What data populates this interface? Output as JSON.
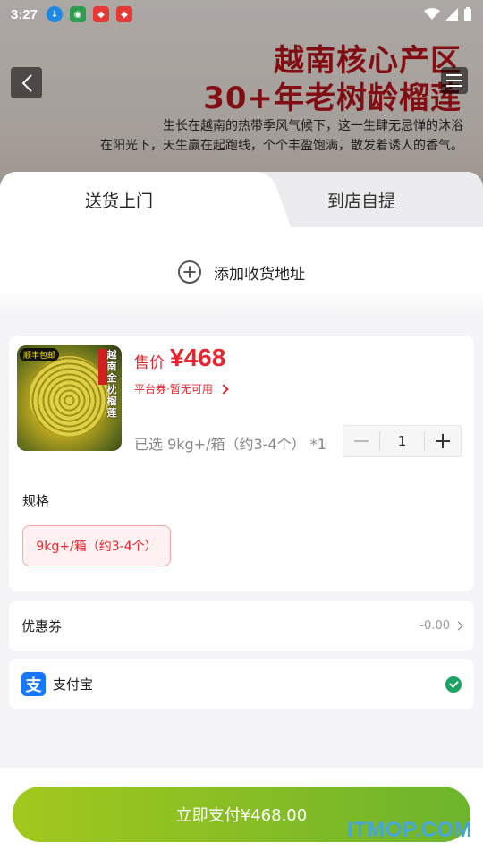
{
  "status_bar": {
    "time": "3:27"
  },
  "hero": {
    "title_line1": "越南核心产区",
    "title_line2": "30+年老树龄榴莲",
    "desc_line1": "生长在越南的热带季风气候下，这一生肆无忌惮的沐浴",
    "desc_line2": "在阳光下，天生赢在起跑线，个个丰盈饱满，散发着诱人的香气。"
  },
  "tabs": [
    {
      "label": "送货上门",
      "active": true
    },
    {
      "label": "到店自提",
      "active": false
    }
  ],
  "address": {
    "add_label": "添加收货地址"
  },
  "product": {
    "image_badge": "顺丰包邮",
    "image_stamp": "越南金枕榴莲",
    "price_label": "售价",
    "price_value": "¥468",
    "coupon_text": "平台券·暂无可用",
    "selected_text": "已选 9kg+/箱（约3-4个） *1",
    "quantity": "1"
  },
  "spec": {
    "title": "规格",
    "options": [
      "9kg+/箱（约3-4个）"
    ]
  },
  "coupon_row": {
    "label": "优惠券",
    "value": "-0.00"
  },
  "payment": {
    "label": "支付宝",
    "icon_char": "支",
    "selected": true
  },
  "footer": {
    "pay_button": "立即支付¥468.00"
  },
  "watermark": "ITMOP.COM",
  "colors": {
    "accent_red": "#e8242c",
    "pay_green_start": "#a2c81d",
    "pay_green_end": "#6db42c",
    "alipay_blue": "#1677ff",
    "check_green": "#1aa260"
  }
}
